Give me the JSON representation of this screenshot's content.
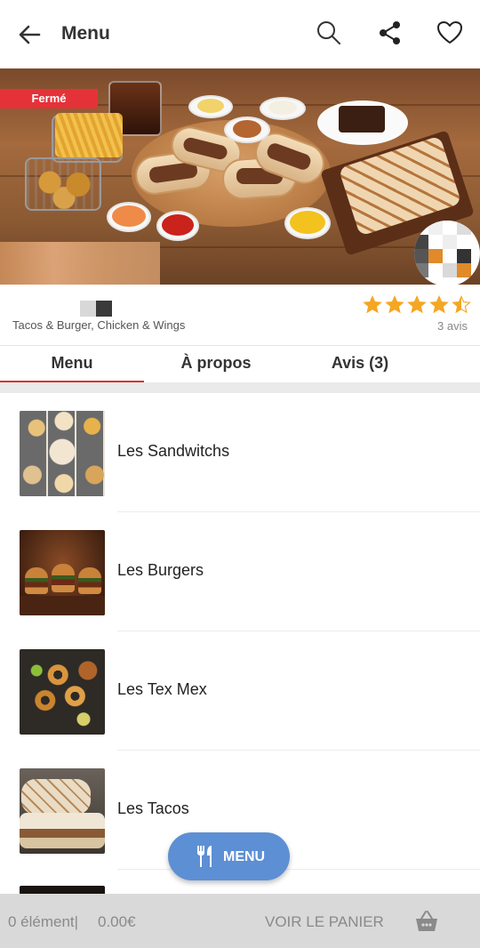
{
  "header": {
    "title": "Menu",
    "icons": [
      "back-arrow-icon",
      "search-icon",
      "share-icon",
      "heart-icon"
    ]
  },
  "hero": {
    "status_badge": "Fermé",
    "colors": {
      "badge": "#e53238"
    }
  },
  "restaurant": {
    "categories": "Tacos & Burger, Chicken & Wings",
    "rating": 4.5,
    "rating_max": 5,
    "reviews_label": "3 avis",
    "star_color": "#f5a623"
  },
  "tabs": [
    {
      "label": "Menu",
      "active": true
    },
    {
      "label": "À propos",
      "active": false
    },
    {
      "label": "Avis (3)",
      "active": false
    }
  ],
  "menu_items": [
    {
      "label": "Les Sandwitchs"
    },
    {
      "label": "Les Burgers"
    },
    {
      "label": "Les Tex Mex"
    },
    {
      "label": "Les Tacos"
    }
  ],
  "fab": {
    "label": "MENU",
    "icon": "fork-knife-icon",
    "color": "#5d8fd4"
  },
  "cart_bar": {
    "count": "0 élément|",
    "total": "0.00€",
    "action": "VOIR LE PANIER",
    "icon": "basket-icon"
  },
  "colors": {
    "accent": "#d9322e",
    "tab_underline": "#d9322e"
  }
}
